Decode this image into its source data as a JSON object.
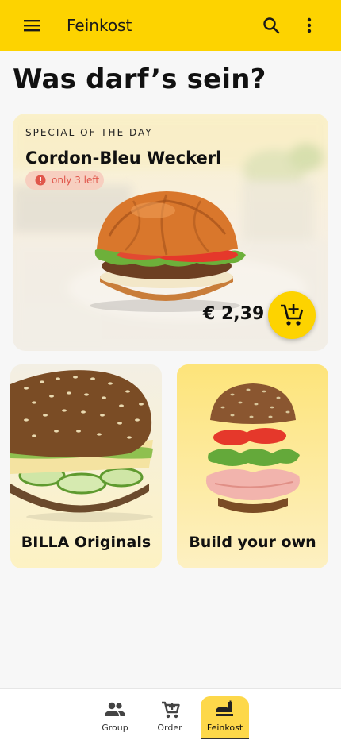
{
  "appbar": {
    "title": "Feinkost",
    "icons": [
      "menu-icon",
      "search-icon",
      "more-vert-icon"
    ],
    "color": "#fdd300"
  },
  "headline": "Was darf’s sein?",
  "special": {
    "eyebrow": "SPECIAL OF THE DAY",
    "name": "Cordon-Bleu Weckerl",
    "stock_badge": "only 3 left",
    "price": "€ 2,39",
    "action_icon": "add-shopping-cart-icon"
  },
  "tiles": [
    {
      "label": "BILLA Originals"
    },
    {
      "label": "Build your own"
    }
  ],
  "bottom_nav": {
    "items": [
      {
        "label": "Group",
        "icon": "group-icon"
      },
      {
        "label": "Order",
        "icon": "cart-icon"
      },
      {
        "label": "Feinkost",
        "icon": "deli-icon",
        "active": true
      }
    ]
  },
  "colors": {
    "accent": "#fdd300",
    "warning": "#e0564b",
    "warning_bg": "#f7cfc0"
  }
}
